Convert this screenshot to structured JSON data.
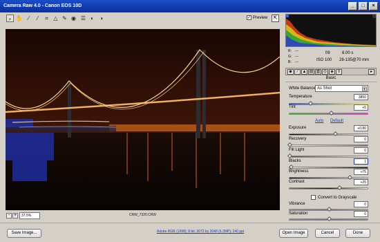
{
  "window": {
    "title": "Camera Raw 4.0  -  Canon EOS 10D"
  },
  "window_buttons": {
    "minimize": "_",
    "maximize": "□",
    "close": "×"
  },
  "toolbar": {
    "preview_label": "Preview",
    "preview_checked": "✓"
  },
  "status": {
    "zoom": "37.5%",
    "filename": "CRW_7320.CRW",
    "zoom_out": "-",
    "zoom_in": "+"
  },
  "readout": {
    "r": "R:",
    "g": "G:",
    "b": "B:",
    "r_val": "---",
    "g_val": "---",
    "b_val": "---",
    "aperture": "f/8",
    "shutter": "8.00 s",
    "iso": "ISO 100",
    "lens": "28-135@70 mm"
  },
  "panel": {
    "section": "Basic",
    "white_balance_label": "White Balance:",
    "white_balance_value": "As Shot",
    "temperature_label": "Temperature",
    "temperature_value": "3850",
    "tint_label": "Tint",
    "tint_value": "+5",
    "auto_label": "Auto",
    "default_label": "Default",
    "exposure_label": "Exposure",
    "exposure_value": "+0.80",
    "recovery_label": "Recovery",
    "recovery_value": "0",
    "filllight_label": "Fill Light",
    "filllight_value": "0",
    "blacks_label": "Blacks",
    "blacks_value": "1",
    "brightness_label": "Brightness",
    "brightness_value": "+75",
    "contrast_label": "Contrast",
    "contrast_value": "+25",
    "grayscale_label": "Convert to Grayscale",
    "vibrance_label": "Vibrance",
    "vibrance_value": "0",
    "saturation_label": "Saturation",
    "saturation_value": "0"
  },
  "bottom": {
    "save_label": "Save Image...",
    "workflow_info": "Adobe RGB (1998); 8 bit; 3072 by 2048 (6.3MP); 240 ppi",
    "open_label": "Open Image",
    "cancel_label": "Cancel",
    "done_label": "Done"
  }
}
